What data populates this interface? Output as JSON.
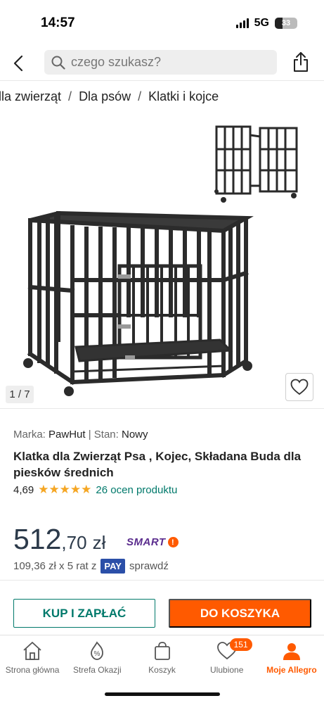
{
  "status": {
    "time": "14:57",
    "network": "5G",
    "battery": "33",
    "battery_level": 0.33
  },
  "search": {
    "placeholder": "czego szukasz?"
  },
  "breadcrumb": [
    "dla zwierząt",
    "Dla psów",
    "Klatki i kojce"
  ],
  "gallery": {
    "counter": "1 / 7"
  },
  "product": {
    "brand_label": "Marka:",
    "brand": "PawHut",
    "separator": "|",
    "condition_label": "Stan:",
    "condition": "Nowy",
    "title": "Klatka dla Zwierząt Psa , Kojec, Składana Buda dla piesków średnich",
    "rating": "4,69",
    "stars": "★★★★★",
    "rating_count": "26 ocen produktu"
  },
  "price": {
    "main": "512",
    "cents": ",70",
    "currency": "zł",
    "smart_label": "SMART",
    "installment_text": "109,36 zł x 5 rat z",
    "pay_label": "PAY",
    "check_label": "sprawdź"
  },
  "actions": {
    "buy_label": "KUP I ZAPŁAĆ",
    "cart_label": "DO KOSZYKA"
  },
  "colors": {
    "accent": "#ff5a00",
    "teal": "#00796b",
    "price": "#2c3a4a",
    "smart": "#5b2d8e"
  },
  "tabs": [
    {
      "label": "Strona główna",
      "icon": "home-icon"
    },
    {
      "label": "Strefa Okazji",
      "icon": "percent-icon"
    },
    {
      "label": "Koszyk",
      "icon": "bag-icon"
    },
    {
      "label": "Ulubione",
      "icon": "heart-icon",
      "badge": "151"
    },
    {
      "label": "Moje Allegro",
      "icon": "user-icon",
      "active": true
    }
  ]
}
